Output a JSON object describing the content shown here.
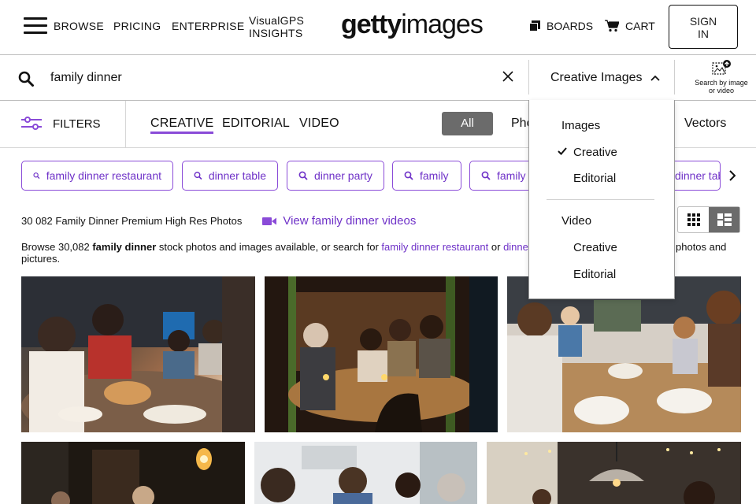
{
  "nav": {
    "browse": "BROWSE",
    "pricing": "PRICING",
    "enterprise": "ENTERPRISE",
    "visualgps_line1": "VisualGPS",
    "visualgps_line2": "INSIGHTS",
    "logo_bold": "getty",
    "logo_light": "images",
    "boards": "BOARDS",
    "cart": "CART",
    "signin_line1": "SIGN",
    "signin_line2": "IN"
  },
  "search": {
    "query": "family dinner",
    "content_type": "Creative Images",
    "search_by_image_line1": "Search by image",
    "search_by_image_line2": "or video"
  },
  "filters": {
    "label": "FILTERS",
    "tabs": [
      "CREATIVE",
      "EDITORIAL",
      "VIDEO"
    ],
    "active_tab": "CREATIVE",
    "all_pill": "All",
    "photos_partial": "Pho",
    "vectors": "Vectors"
  },
  "chips": [
    "family dinner restaurant",
    "dinner table",
    "dinner party",
    "family",
    "family",
    "dinner tab"
  ],
  "results": {
    "count_line": "30 082 Family Dinner Premium High Res Photos",
    "video_link": "View family dinner videos",
    "browse_pre": "Browse 30,082 ",
    "browse_bold": "family dinner",
    "browse_mid": " stock photos and images available, or search for ",
    "browse_link1": "family dinner restaurant",
    "browse_or": " or ",
    "browse_link2": "dinne",
    "browse_tail": "photos and",
    "browse_line2": "pictures."
  },
  "dropdown": {
    "images_header": "Images",
    "images_creative": "Creative",
    "images_editorial": "Editorial",
    "video_header": "Video",
    "video_creative": "Creative",
    "video_editorial": "Editorial",
    "selected": "images_creative"
  },
  "colors": {
    "accent": "#8a4bd8",
    "link": "#6f32c8",
    "pill_bg": "#6b6b6b"
  }
}
